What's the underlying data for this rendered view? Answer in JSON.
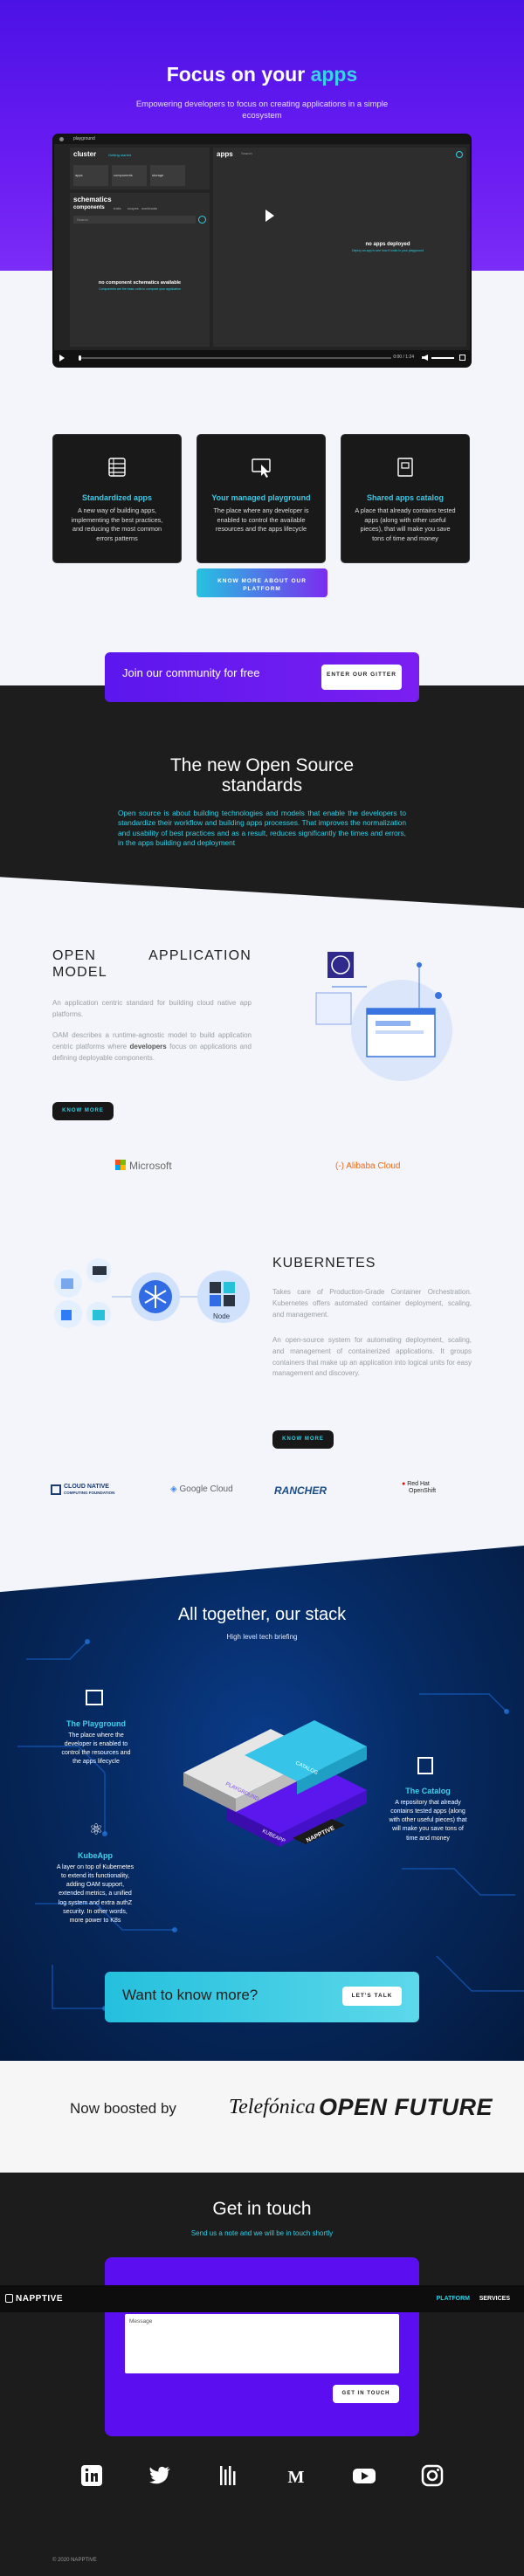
{
  "hero": {
    "title_prefix": "Focus on your ",
    "title_accent": "apps",
    "subtitle": "Empowering developers to focus on creating applications in a simple ecosystem"
  },
  "video": {
    "brand": "playground",
    "cluster_label": "cluster",
    "cluster_sub": "Getting started",
    "stat_labels": [
      "apps",
      "components",
      "storage"
    ],
    "schematics_label": "schematics",
    "components_tab": "components",
    "components_tabs": [
      "traits",
      "scopes",
      "workloads"
    ],
    "search_placeholder": "Search",
    "no_components_title": "no component schematics available",
    "no_components_sub": "Components are the basic units to compose your application",
    "apps_label": "apps",
    "apps_search": "Search",
    "no_apps_title": "no apps deployed",
    "no_apps_sub": "Deploy an app to see how it looks in your playground",
    "time": "0:00 / 1:24"
  },
  "features": [
    {
      "icon": "server-icon",
      "title": "Standardized apps",
      "desc": "A new way of building apps, implementing the best practices, and reducing the most common errors patterns"
    },
    {
      "icon": "cursor-window-icon",
      "title": "Your managed playground",
      "desc": "The place where any developer is enabled to control the available resources and the apps lifecycle"
    },
    {
      "icon": "catalog-icon",
      "title": "Shared apps catalog",
      "desc": "A place that already contains tested apps (along with other useful pieces), that will make you save tons of time and money"
    }
  ],
  "know_more_platform": "KNOW MORE ABOUT OUR PLATFORM",
  "community": {
    "text": "Join our community for free",
    "button": "ENTER OUR GITTER"
  },
  "open_source": {
    "title": "The new Open Source standards",
    "text": "Open source is about building technologies and models that enable the developers to standardize their workflow and building apps processes. That improves the normalization and usability of best practices and as a result, reduces significantly the times and errors, in the apps building and deployment"
  },
  "oam": {
    "title": "OPEN APPLICATION MODEL",
    "p1": "An application centric standard for building cloud native app platforms.",
    "p2_a": "OAM describes a runtime-agnostic model to build application centric platforms where ",
    "p2_bold": "developers",
    "p2_b": " focus on applications and defining deployable components.",
    "button": "KNOW MORE",
    "partners": [
      "Microsoft",
      "Alibaba Cloud"
    ]
  },
  "kubernetes": {
    "title": "KUBERNETES",
    "p1": "Takes care of Production-Grade Container Orchestration. Kubernetes offers automated container deployment, scaling, and management.",
    "p2": "An open-source system for automating deployment, scaling, and management of containerized applications. It groups containers that make up an application into logical units for easy management and discovery.",
    "button": "KNOW MORE",
    "node_label": "Node",
    "partners": [
      "CLOUD NATIVE",
      "COMPUTING FOUNDATION",
      "Google Cloud",
      "RANCHER",
      "Red Hat",
      "OpenShift"
    ]
  },
  "stack": {
    "title": "All together, our stack",
    "subtitle": "High level tech briefing",
    "playground_title": "The Playground",
    "playground_desc": "The place where the developer is enabled to control the resources and the apps lifecycle",
    "catalog_title": "The Catalog",
    "catalog_desc": "A repository that already contains tested apps (along with other useful pieces) that will make you save tons of time and money",
    "kubeapp_title": "KubeApp",
    "kubeapp_desc": "A layer on top of Kubernetes to extend its functionality, adding OAM support, extended metrics, a unified log system and extra authZ security. In other words, more power to K8s",
    "layers": [
      "CATALOG",
      "PLAYGROUND",
      "KUBEAPP"
    ],
    "brand": "NAPPTIVE"
  },
  "talk": {
    "text": "Want to know more?",
    "button": "LET'S TALK"
  },
  "boosted": {
    "text": "Now boosted by",
    "telefonica": "Telefónica",
    "open_future": "OPEN FUTURE"
  },
  "contact": {
    "title": "Get in touch",
    "subtitle": "Send us a note and we will be in touch shortly",
    "message_label": "Message",
    "button": "GET IN TOUCH"
  },
  "navbar": {
    "logo": "NAPPTIVE",
    "items": [
      "PLATFORM",
      "SERVICES"
    ]
  },
  "social": [
    "linkedin-icon",
    "twitter-icon",
    "podcast-icon",
    "medium-icon",
    "youtube-icon",
    "instagram-icon"
  ],
  "copyright": "© 2020 NAPPTIVE",
  "colors": {
    "purple": "#5b0ff0",
    "cyan": "#2fd0e6",
    "dark": "#1c1c1c"
  }
}
